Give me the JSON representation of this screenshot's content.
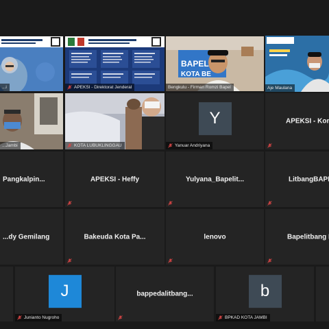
{
  "tiles": {
    "t1": {
      "name": "...i",
      "slide_title": "KELAS KONSULTASI/HELP DESK SIPD"
    },
    "t2": {
      "name": "APEKSI - Direktorat Jenderal",
      "slide_title": "KELAS KONSULTASI/HELP DESK SIPD",
      "slide_sub": "KOMISARIAT WILAYAH (KORWIL) I-VI"
    },
    "t3": {
      "name": "Bengkulu - Firman Romzi Bapel",
      "banner": "BAPELITBANG KOTA BE..."
    },
    "t4": {
      "name": "Aje Maulana",
      "slide_caption": "LATAR BELAKANG PENYELENGGARAAN SIPD"
    },
    "t5": {
      "name": "...Jambi"
    },
    "t6": {
      "name": "KOTA LUBUKLINGGAU"
    },
    "t7": {
      "name": "Yanuar Andriyana",
      "initial": "Y"
    },
    "t8": {
      "center": "APEKSI - Kom..."
    },
    "t9": {
      "center": "Pangkalpin..."
    },
    "t10": {
      "center": "APEKSI - Heffy"
    },
    "t11": {
      "center": "Yulyana_Bapelit..."
    },
    "t12": {
      "center": "LitbangBAPP..."
    },
    "t13": {
      "center": "...dy Gemilang"
    },
    "t14": {
      "center": "Bakeuda Kota Pa..."
    },
    "t15": {
      "center": "lenovo"
    },
    "t16": {
      "center": "Bapelitbang K..."
    },
    "t17": {
      "name": "Junianto Nugroho",
      "initial": "J"
    },
    "t18": {
      "center": "bappedalitbang..."
    },
    "t19": {
      "name": "BPKAD KOTA JAMBI",
      "initial": "b"
    }
  },
  "colors": {
    "tile_bg": "#242424",
    "page_bg": "#1a1a1a",
    "muted_icon": "#d64545",
    "avatar_blue": "#1e88d8",
    "avatar_slate": "#3e4a55",
    "active_speaker": "#c7dc3c"
  },
  "icons": {
    "mic_muted": "mic-muted-icon"
  }
}
